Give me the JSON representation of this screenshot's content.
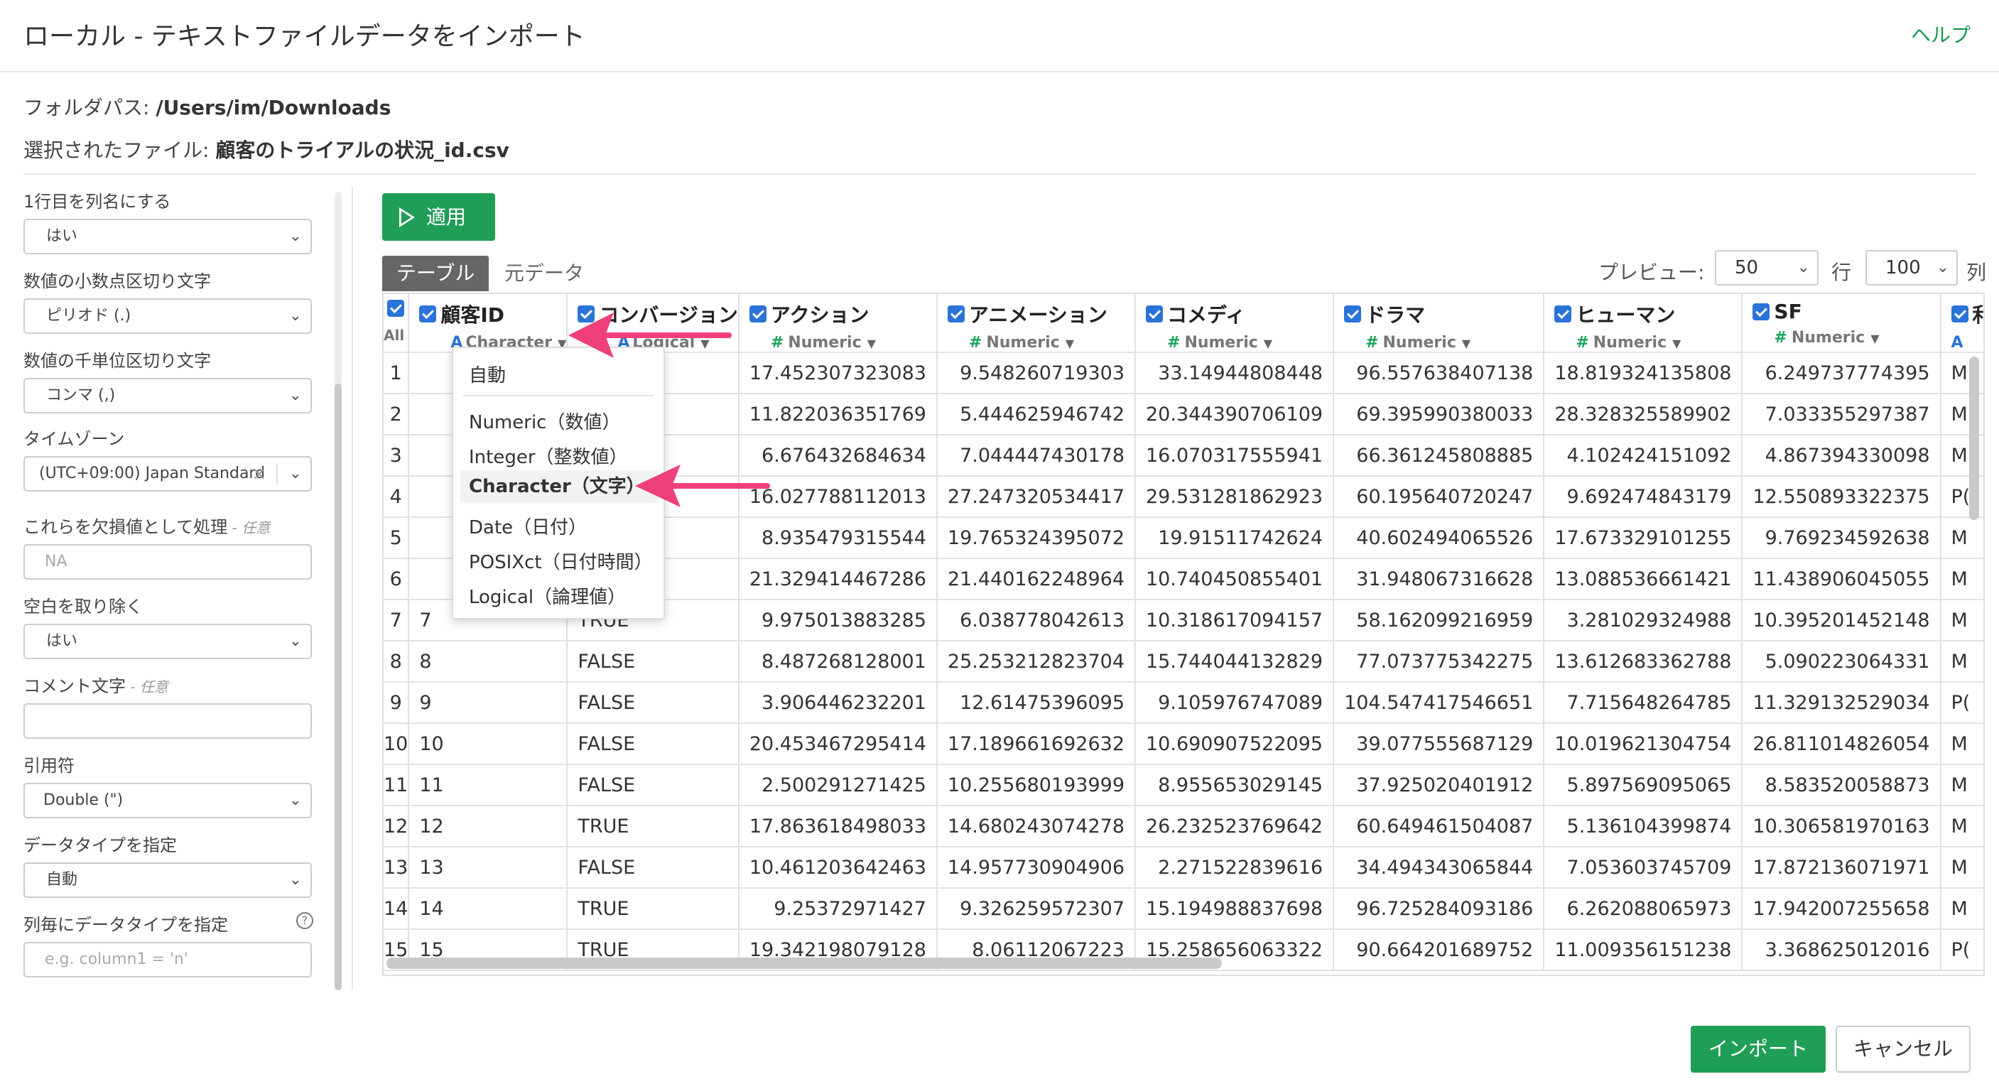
{
  "dialog": {
    "title": "ローカル - テキストファイルデータをインポート",
    "help_link": "ヘルプ",
    "folder_path_label": "フォルダパス:",
    "folder_path": "/Users/im/Downloads",
    "selected_file_label": "選択されたファイル:",
    "selected_file": "顧客のトライアルの状況_id.csv"
  },
  "settings": {
    "header_row_label": "1行目を列名にする",
    "header_row_value": "はい",
    "decimal_sep_label": "数値の小数点区切り文字",
    "decimal_sep_value": "ピリオド (.)",
    "thousand_sep_label": "数値の千単位区切り文字",
    "thousand_sep_value": "コンマ (,)",
    "timezone_label": "タイムゾーン",
    "timezone_value": "(UTC+09:00) Japan Standard",
    "na_label": "これらを欠損値として処理",
    "na_optional": " - 任意",
    "na_placeholder": "NA",
    "trim_label": "空白を取り除く",
    "trim_value": "はい",
    "comment_label": "コメント文字",
    "comment_optional": " - 任意",
    "comment_value": "",
    "quote_label": "引用符",
    "quote_value": "Double (\")",
    "datatype_label": "データタイプを指定",
    "datatype_value": "自動",
    "col_datatype_label": "列毎にデータタイプを指定",
    "col_datatype_help": "?",
    "col_datatype_placeholder": "e.g. column1 = 'n'"
  },
  "toolbar": {
    "apply_label": "適用",
    "tab_table": "テーブル",
    "tab_raw": "元データ",
    "preview_label": "プレビュー:",
    "preview_rows": "50",
    "rows_unit": "行",
    "preview_cols": "100",
    "cols_unit": "列"
  },
  "table": {
    "all_label": "All",
    "columns": [
      {
        "name": "顧客ID",
        "type": "Character",
        "icon": "A"
      },
      {
        "name": "コンバージョン",
        "type": "Logical",
        "icon": "A"
      },
      {
        "name": "アクション",
        "type": "Numeric",
        "icon": "#"
      },
      {
        "name": "アニメーション",
        "type": "Numeric",
        "icon": "#"
      },
      {
        "name": "コメディ",
        "type": "Numeric",
        "icon": "#"
      },
      {
        "name": "ドラマ",
        "type": "Numeric",
        "icon": "#"
      },
      {
        "name": "ヒューマン",
        "type": "Numeric",
        "icon": "#"
      },
      {
        "name": "SF",
        "type": "Numeric",
        "icon": "#"
      },
      {
        "name": "利",
        "type": "",
        "icon": "A"
      }
    ],
    "rows": [
      [
        "1",
        "",
        "",
        "17.452307323083",
        "9.548260719303",
        "33.14944808448",
        "96.557638407138",
        "18.819324135808",
        "6.249737774395",
        "M"
      ],
      [
        "2",
        "",
        "",
        "11.822036351769",
        "5.444625946742",
        "20.344390706109",
        "69.395990380033",
        "28.328325589902",
        "7.033355297387",
        "M"
      ],
      [
        "3",
        "",
        "",
        "6.676432684634",
        "7.044447430178",
        "16.070317555941",
        "66.361245808885",
        "4.102424151092",
        "4.867394330098",
        "M"
      ],
      [
        "4",
        "",
        "",
        "16.027788112013",
        "27.247320534417",
        "29.531281862923",
        "60.195640720247",
        "9.692474843179",
        "12.550893322375",
        "P("
      ],
      [
        "5",
        "",
        "",
        "8.935479315544",
        "19.765324395072",
        "19.91511742624",
        "40.602494065526",
        "17.673329101255",
        "9.769234592638",
        "M"
      ],
      [
        "6",
        "",
        "",
        "21.329414467286",
        "21.440162248964",
        "10.740450855401",
        "31.948067316628",
        "13.088536661421",
        "11.438906045055",
        "M"
      ],
      [
        "7",
        "7",
        "TRUE",
        "9.975013883285",
        "6.038778042613",
        "10.318617094157",
        "58.162099216959",
        "3.281029324988",
        "10.395201452148",
        "M"
      ],
      [
        "8",
        "8",
        "FALSE",
        "8.487268128001",
        "25.253212823704",
        "15.744044132829",
        "77.073775342275",
        "13.612683362788",
        "5.090223064331",
        "M"
      ],
      [
        "9",
        "9",
        "FALSE",
        "3.906446232201",
        "12.61475396095",
        "9.105976747089",
        "104.547417546651",
        "7.715648264785",
        "11.329132529034",
        "P("
      ],
      [
        "10",
        "10",
        "FALSE",
        "20.453467295414",
        "17.189661692632",
        "10.690907522095",
        "39.077555687129",
        "10.019621304754",
        "26.811014826054",
        "M"
      ],
      [
        "11",
        "11",
        "FALSE",
        "2.500291271425",
        "10.255680193999",
        "8.955653029145",
        "37.925020401912",
        "5.897569095065",
        "8.583520058873",
        "M"
      ],
      [
        "12",
        "12",
        "TRUE",
        "17.863618498033",
        "14.680243074278",
        "26.232523769642",
        "60.649461504087",
        "5.136104399874",
        "10.306581970163",
        "M"
      ],
      [
        "13",
        "13",
        "FALSE",
        "10.461203642463",
        "14.957730904906",
        "2.271522839616",
        "34.494343065844",
        "7.053603745709",
        "17.872136071971",
        "M"
      ],
      [
        "14",
        "14",
        "TRUE",
        "9.25372971427",
        "9.326259572307",
        "15.194988837698",
        "96.725284093186",
        "6.262088065973",
        "17.942007255658",
        "M"
      ],
      [
        "15",
        "15",
        "TRUE",
        "19.342198079128",
        "8.06112067223",
        "15.258656063322",
        "90.664201689752",
        "11.009356151238",
        "3.368625012016",
        "P("
      ]
    ]
  },
  "type_menu": {
    "auto": "自動",
    "items": [
      "Numeric（数値）",
      "Integer（整数値）",
      "Character（文字）",
      "Date（日付）",
      "POSIXct（日付時間）",
      "Logical（論理値）"
    ]
  },
  "footer": {
    "import_label": "インポート",
    "cancel_label": "キャンセル"
  },
  "colors": {
    "accent_green": "#1f9e57",
    "checkbox_blue": "#2a73d9",
    "annotation_arrow": "#f0407a"
  }
}
